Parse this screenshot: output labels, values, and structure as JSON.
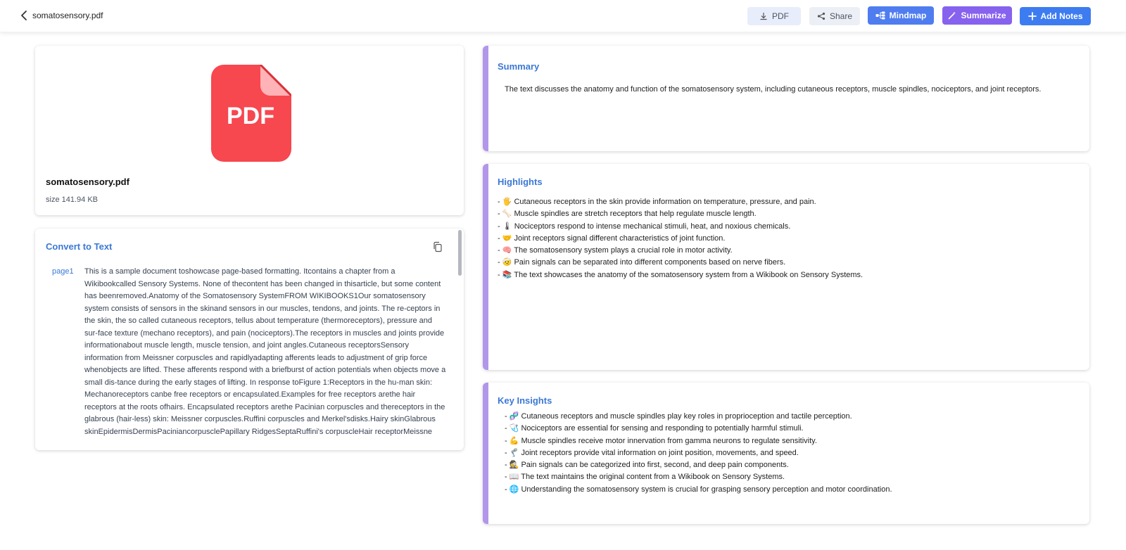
{
  "header": {
    "file_name": "somatosensory.pdf",
    "buttons": {
      "pdf": "PDF",
      "share": "Share",
      "mindmap": "Mindmap",
      "summarize": "Summarize",
      "add_notes": "Add Notes"
    }
  },
  "file_card": {
    "icon_label": "PDF",
    "name": "somatosensory.pdf",
    "size": "size 141.94 KB"
  },
  "convert": {
    "title": "Convert to Text",
    "page_label": "page1",
    "text": "This is a sample document toshowcase page-based formatting. Itcontains a chapter from a Wikibookcalled Sensory Systems. None of thecontent has been changed in thisarticle, but some content has beenremoved.Anatomy of the Somatosensory SystemFROM WIKIBOOKS1Our somatosensory system consists of sensors in the skinand sensors in our muscles, tendons, and joints. The re-ceptors in the skin, the so called cutaneous receptors, tellus about temperature (thermoreceptors), pressure and sur-face texture (mechano receptors), and pain (nociceptors).The receptors in muscles and joints provide informationabout muscle length, muscle tension, and joint angles.Cutaneous receptorsSensory information from Meissner corpuscles and rapidlyadapting afferents leads to adjustment of grip force whenobjects are lifted. These afferents respond with a briefburst of action potentials when objects move a small dis-tance during the early stages of lifting. In response toFigure 1:Receptors in the hu-man skin: Mechanoreceptors canbe free receptors or encapsulated.Examples for free receptors arethe hair receptors at the roots ofhairs. Encapsulated receptors arethe Pacinian corpuscles and thereceptors in the glabrous (hair-less) skin: Meissner corpuscles.Ruffini corpuscles and Merkel'sdisks.Hairy skinGlabrous skinEpidermisDermisPaciniancorpusclePapillary RidgesSeptaRuffini's corpuscleHair receptorMeissne"
  },
  "summary": {
    "title": "Summary",
    "text": "The text discusses the anatomy and function of the somatosensory system, including cutaneous receptors, muscle spindles, nociceptors, and joint receptors."
  },
  "highlights": {
    "title": "Highlights",
    "items": [
      "- 🖐 Cutaneous receptors in the skin provide information on temperature, pressure, and pain.",
      "- 🦴 Muscle spindles are stretch receptors that help regulate muscle length.",
      "- 🌡 Nociceptors respond to intense mechanical stimuli, heat, and noxious chemicals.",
      "- 🤝 Joint receptors signal different characteristics of joint function.",
      "- 🧠 The somatosensory system plays a crucial role in motor activity.",
      "- 🤕 Pain signals can be separated into different components based on nerve fibers.",
      "- 📚 The text showcases the anatomy of the somatosensory system from a Wikibook on Sensory Systems."
    ]
  },
  "insights": {
    "title": "Key Insights",
    "items": [
      "- 🧬 Cutaneous receptors and muscle spindles play key roles in proprioception and tactile perception.",
      "- 🩺 Nociceptors are essential for sensing and responding to potentially harmful stimuli.",
      "- 💪 Muscle spindles receive motor innervation from gamma neurons to regulate sensitivity.",
      "- 🦿 Joint receptors provide vital information on joint position, movements, and speed.",
      "- 🕵 Pain signals can be categorized into first, second, and deep pain components.",
      "- 📖 The text maintains the original content from a Wikibook on Sensory Systems.",
      "- 🌐 Understanding the somatosensory system is crucial for grasping sensory perception and motor coordination."
    ]
  },
  "colors": {
    "accent_blue": "#3b78d4",
    "accent_purple": "#8662ee",
    "pdf_red": "#f7474f",
    "card_accent": "#b296ea"
  }
}
